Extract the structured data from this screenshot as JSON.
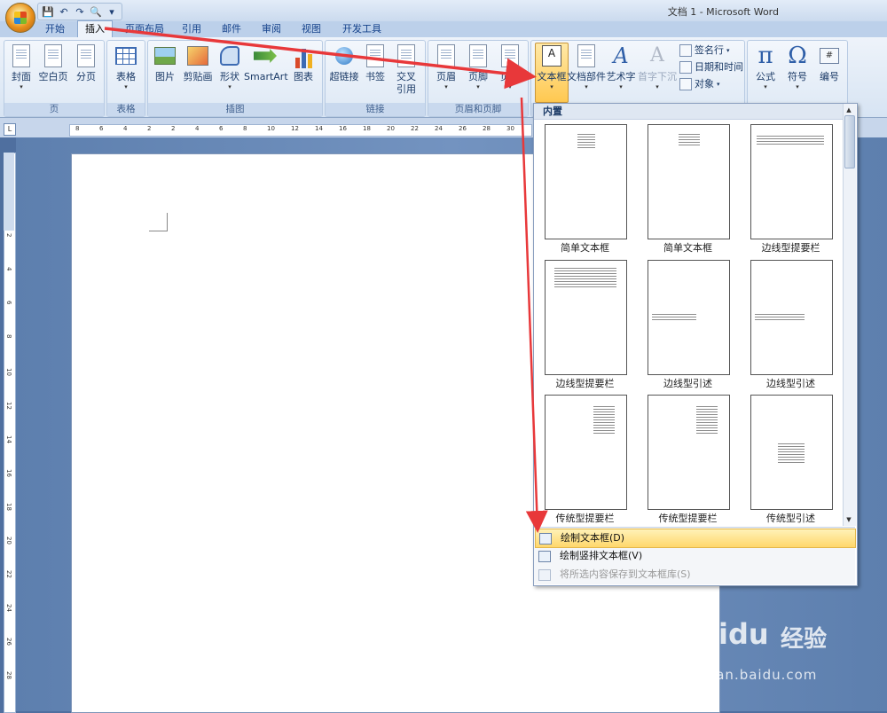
{
  "window": {
    "title": "文档 1 - Microsoft Word"
  },
  "qat": {
    "save": "💾",
    "undo": "↶",
    "redo": "↷",
    "print": "🔍",
    "more": "▾"
  },
  "tabs": [
    "开始",
    "插入",
    "页面布局",
    "引用",
    "邮件",
    "审阅",
    "视图",
    "开发工具"
  ],
  "active_tab": "插入",
  "groups": {
    "pages": {
      "label": "页",
      "buttons": [
        "封面",
        "空白页",
        "分页"
      ]
    },
    "tables": {
      "label": "表格",
      "buttons": [
        "表格"
      ]
    },
    "illustrations": {
      "label": "插图",
      "buttons": [
        "图片",
        "剪贴画",
        "形状",
        "SmartArt",
        "图表"
      ]
    },
    "links": {
      "label": "链接",
      "buttons": [
        "超链接",
        "书签",
        "交叉",
        "引用"
      ]
    },
    "header_footer": {
      "label": "页眉和页脚",
      "buttons": [
        "页眉",
        "页脚",
        "页码"
      ]
    },
    "text": {
      "buttons": [
        "文本框",
        "文档部件",
        "艺术字",
        "首字下沉"
      ],
      "small": [
        "签名行",
        "日期和时间",
        "对象"
      ]
    },
    "symbols": {
      "buttons": [
        "公式",
        "符号",
        "编号"
      ]
    }
  },
  "ruler": {
    "h_ticks": [
      "8",
      "6",
      "4",
      "2",
      "2",
      "4",
      "6",
      "8",
      "10",
      "12",
      "14",
      "16",
      "18",
      "20",
      "22",
      "24",
      "26",
      "28",
      "30"
    ],
    "v_ticks": [
      "4",
      "2",
      "2",
      "4",
      "6",
      "8",
      "10",
      "12",
      "14",
      "16",
      "18",
      "20",
      "22",
      "24",
      "26",
      "28"
    ]
  },
  "gallery": {
    "header": "内置",
    "items": [
      "简单文本框",
      "简单文本框",
      "边线型提要栏",
      "边线型提要栏",
      "边线型引述",
      "边线型引述",
      "传统型提要栏",
      "传统型提要栏",
      "传统型引述"
    ]
  },
  "menu": {
    "draw": "绘制文本框(D)",
    "draw_vertical": "绘制竖排文本框(V)",
    "save_selection": "将所选内容保存到文本框库(S)"
  },
  "watermark": {
    "brand": "Baidu",
    "brand_cn": "经验",
    "url": "jingyan.baidu.com"
  },
  "colors": {
    "accent": "#ffd76b",
    "arrow": "#e8383a",
    "ribbon": "#dde8f5"
  }
}
